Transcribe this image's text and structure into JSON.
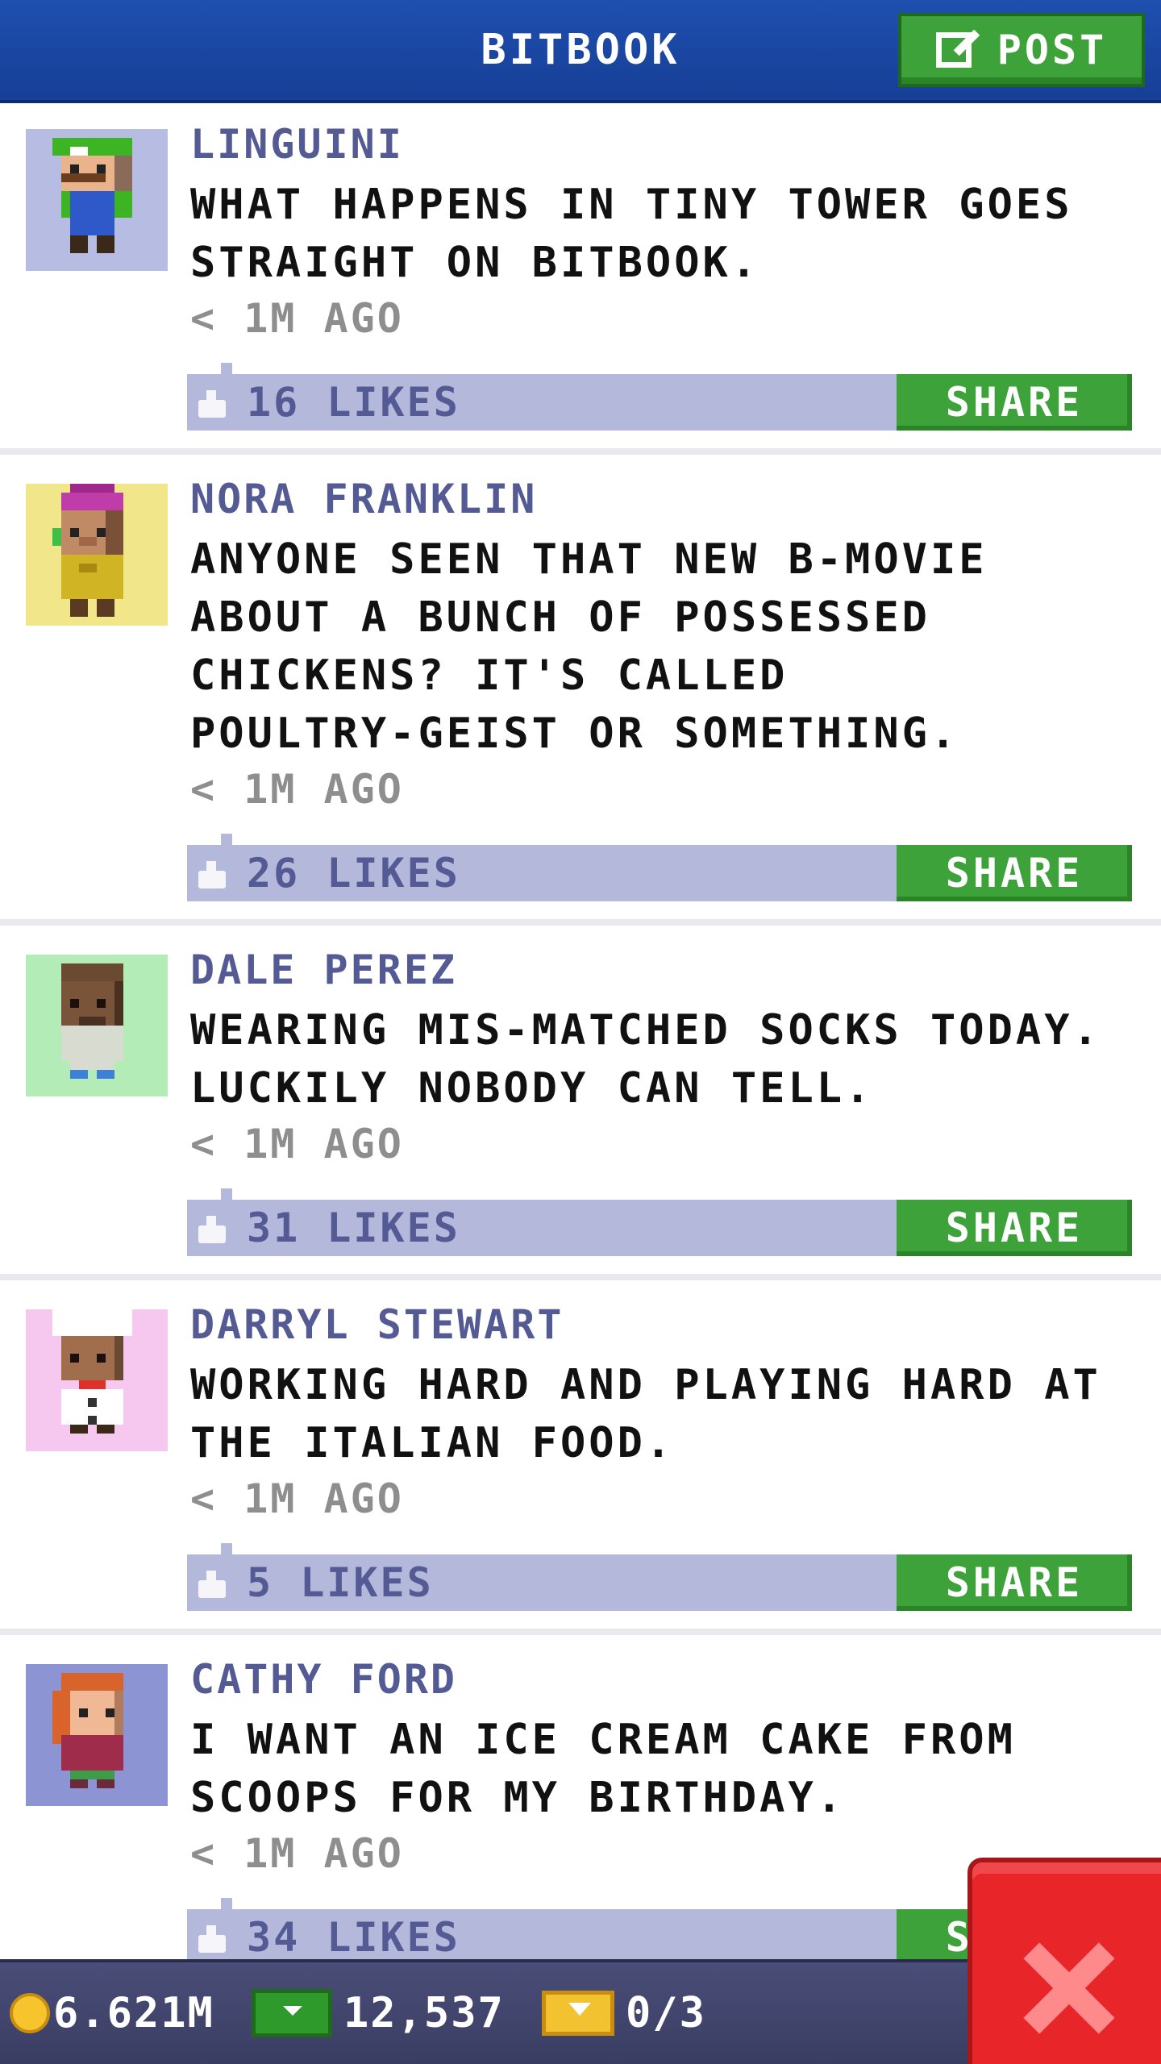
{
  "header": {
    "title": "BITBOOK",
    "post_label": "POST"
  },
  "feed": {
    "posts": [
      {
        "author": "LINGUINI",
        "message_lines": [
          "WHAT HAPPENS IN TINY TOWER GOES",
          "STRAIGHT ON BITBOOK."
        ],
        "time": "< 1M AGO",
        "likes": "16 LIKES",
        "share_label": "SHARE",
        "avatar_bg": "#b7bde2",
        "avatar_icon": "plumber-avatar-icon"
      },
      {
        "author": "NORA FRANKLIN",
        "message_lines": [
          "ANYONE SEEN THAT NEW B-MOVIE",
          "ABOUT A BUNCH OF POSSESSED",
          "CHICKENS? IT'S CALLED",
          "POULTRY-GEIST OR SOMETHING."
        ],
        "time": "< 1M AGO",
        "likes": "26 LIKES",
        "share_label": "SHARE",
        "avatar_bg": "#f2e68a",
        "avatar_icon": "woman-purple-hat-avatar-icon"
      },
      {
        "author": "DALE PEREZ",
        "message_lines": [
          "WEARING MIS-MATCHED SOCKS TODAY.",
          "LUCKILY NOBODY CAN TELL."
        ],
        "time": "< 1M AGO",
        "likes": "31 LIKES",
        "share_label": "SHARE",
        "avatar_bg": "#b4ecb8",
        "avatar_icon": "bald-man-avatar-icon"
      },
      {
        "author": "DARRYL STEWART",
        "message_lines": [
          "WORKING HARD AND PLAYING HARD AT",
          "THE ITALIAN FOOD."
        ],
        "time": "< 1M AGO",
        "likes": "5 LIKES",
        "share_label": "SHARE",
        "avatar_bg": "#f7c8ef",
        "avatar_icon": "chef-avatar-icon"
      },
      {
        "author": "CATHY FORD",
        "message_lines": [
          "I WANT AN ICE CREAM CAKE FROM",
          "SCOOPS FOR MY BIRTHDAY."
        ],
        "time": "< 1M AGO",
        "likes": "34 LIKES",
        "share_label": "SHARE",
        "avatar_bg": "#8c94d4",
        "avatar_icon": "redhead-woman-avatar-icon"
      }
    ]
  },
  "status_bar": {
    "coins": "6.621M",
    "bux": "12,537",
    "tickets": "0/3"
  },
  "colors": {
    "header_blue": "#1f4fb0",
    "share_green": "#3ea23a",
    "likes_bar": "#b4b8da",
    "author_text": "#545a94",
    "close_red": "#e8262a"
  }
}
